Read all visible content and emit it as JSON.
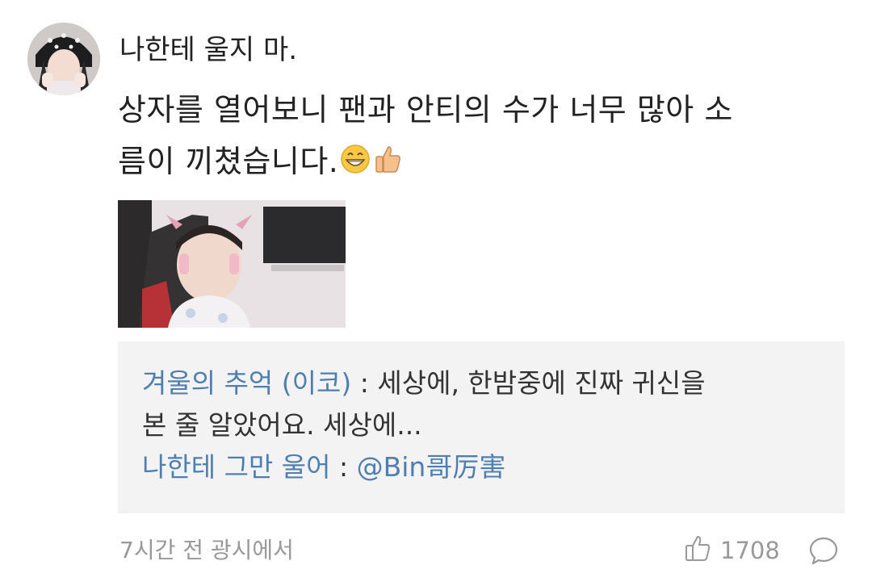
{
  "comment": {
    "author_line": "나한테 울지 마.",
    "body_line1": "상자를 열어보니 팬과 안티의 수가 너무 많아 소",
    "body_line2": "름이 끼쳤습니다.",
    "emojis": [
      "grinning-face-icon",
      "thumbs-up-icon"
    ],
    "time_location": "7시간 전 광시에서",
    "like_count": "1708"
  },
  "replies": [
    {
      "name": "겨울의 추억 (이코)",
      "separator": " : ",
      "text_line1": "세상에, 한밤중에 진짜 귀신을",
      "text_line2": "본 줄 알았어요. 세상에..."
    },
    {
      "name": "나한테 그만 울어",
      "separator": " : ",
      "text": "@Bin哥厉害"
    }
  ],
  "colors": {
    "link_blue": "#4f7fb0",
    "meta_gray": "#999999",
    "reply_bg": "#f3f3f3"
  }
}
